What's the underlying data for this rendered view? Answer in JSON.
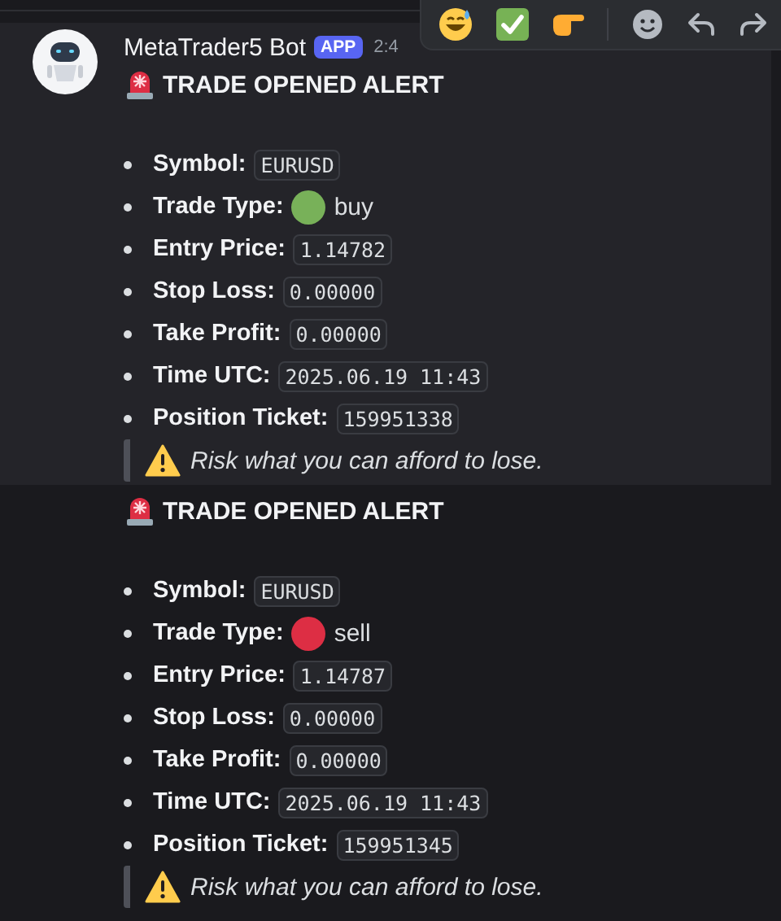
{
  "messages": [
    {
      "hovered": true,
      "author": "MetaTrader5 Bot",
      "badge": "APP",
      "time": "2:4",
      "title": "TRADE OPENED ALERT",
      "fields": [
        {
          "kind": "code",
          "label": "Symbol:",
          "value": "EURUSD"
        },
        {
          "kind": "dot",
          "label": "Trade Type:",
          "value": "buy",
          "color": "#78b159"
        },
        {
          "kind": "code",
          "label": "Entry Price:",
          "value": "1.14782"
        },
        {
          "kind": "code",
          "label": "Stop Loss:",
          "value": "0.00000"
        },
        {
          "kind": "code",
          "label": "Take Profit:",
          "value": "0.00000"
        },
        {
          "kind": "code",
          "label": "Time UTC:",
          "value": "2025.06.19 11:43"
        },
        {
          "kind": "code",
          "label": "Position Ticket:",
          "value": "159951338"
        }
      ],
      "quote": "Risk what you can afford to lose."
    },
    {
      "hovered": false,
      "title": "TRADE OPENED ALERT",
      "fields": [
        {
          "kind": "code",
          "label": "Symbol:",
          "value": "EURUSD"
        },
        {
          "kind": "dot",
          "label": "Trade Type:",
          "value": "sell",
          "color": "#dd2e44"
        },
        {
          "kind": "code",
          "label": "Entry Price:",
          "value": "1.14787"
        },
        {
          "kind": "code",
          "label": "Stop Loss:",
          "value": "0.00000"
        },
        {
          "kind": "code",
          "label": "Take Profit:",
          "value": "0.00000"
        },
        {
          "kind": "code",
          "label": "Time UTC:",
          "value": "2025.06.19 11:43"
        },
        {
          "kind": "code",
          "label": "Position Ticket:",
          "value": "159951345"
        }
      ],
      "quote": "Risk what you can afford to lose."
    }
  ]
}
